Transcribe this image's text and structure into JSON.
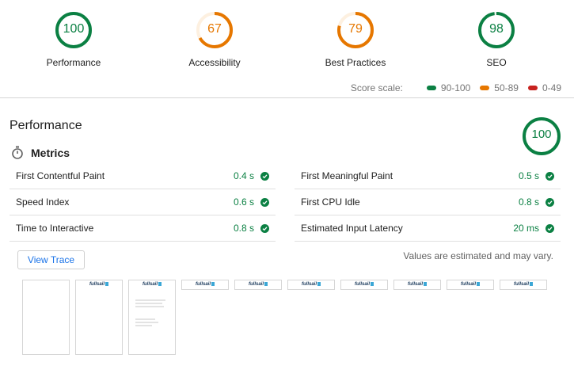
{
  "categories": [
    {
      "score": "100",
      "label": "Performance",
      "value": 100,
      "color": "#0b8043"
    },
    {
      "score": "67",
      "label": "Accessibility",
      "value": 67,
      "color": "#e67700"
    },
    {
      "score": "79",
      "label": "Best Practices",
      "value": 79,
      "color": "#e67700"
    },
    {
      "score": "98",
      "label": "SEO",
      "value": 98,
      "color": "#0b8043"
    }
  ],
  "score_scale": {
    "label": "Score scale:",
    "ranges": [
      {
        "label": "90-100",
        "color": "#0b8043"
      },
      {
        "label": "50-89",
        "color": "#e67700"
      },
      {
        "label": "0-49",
        "color": "#c7221f"
      }
    ]
  },
  "performance": {
    "title": "Performance",
    "score": "100",
    "value": 100,
    "color": "#0b8043"
  },
  "metrics": {
    "heading": "Metrics",
    "icon": "stopwatch-icon",
    "left": [
      {
        "name": "First Contentful Paint",
        "value": "0.4 s"
      },
      {
        "name": "Speed Index",
        "value": "0.6 s"
      },
      {
        "name": "Time to Interactive",
        "value": "0.8 s"
      }
    ],
    "right": [
      {
        "name": "First Meaningful Paint",
        "value": "0.5 s"
      },
      {
        "name": "First CPU Idle",
        "value": "0.8 s"
      },
      {
        "name": "Estimated Input Latency",
        "value": "20 ms"
      }
    ],
    "pass_color": "#0b8043"
  },
  "trace_button": "View Trace",
  "estimate_note": "Values are estimated and may vary.",
  "filmstrip": {
    "logo_text": "fullsail",
    "frame_count": 10
  }
}
